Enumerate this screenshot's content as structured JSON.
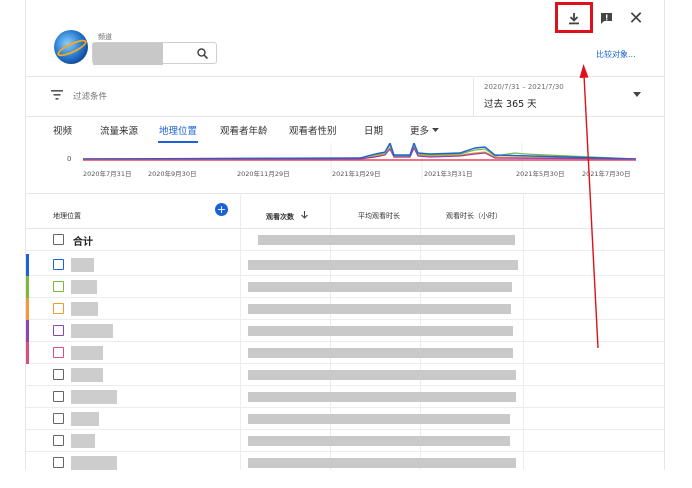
{
  "toolbar": {
    "download_icon": "download-icon",
    "feedback_icon": "feedback-icon",
    "close_label": "✕"
  },
  "channel": {
    "label": "频道",
    "compare_label": "比较对象..."
  },
  "filter": {
    "label": "过滤条件"
  },
  "date": {
    "range": "2020/7/31 – 2021/7/30",
    "label": "过去 365 天"
  },
  "tabs": [
    {
      "label": "视频"
    },
    {
      "label": "流量来源"
    },
    {
      "label": "地理位置"
    },
    {
      "label": "观看者年龄"
    },
    {
      "label": "观看者性别"
    },
    {
      "label": "日期"
    },
    {
      "label": "更多"
    }
  ],
  "chart_data": {
    "type": "line",
    "y_min_label": "0",
    "x_ticks": [
      "2020年7月31日",
      "2020年9月30日",
      "2020年11月29日",
      "2021年1月29日",
      "2021年3月31日",
      "2021年5月30日",
      "2021年7月30日"
    ],
    "series_colors": [
      "#1a62d6",
      "#e8425a",
      "#f29a38",
      "#7cb83d",
      "#8e44ad"
    ]
  },
  "table": {
    "headers": {
      "location": "地理位置",
      "views": "观看次数",
      "avg_duration": "平均观看时长",
      "watch_time": "观看时长（小时）"
    },
    "total_label": "合计",
    "row_colors": [
      "#1a62d6",
      "#7cb83d",
      "#f29a38",
      "#8e44ad",
      "#d9507a",
      "",
      "",
      "",
      "",
      "",
      ""
    ]
  },
  "colors": {
    "accent": "#1a62d6",
    "annotation": "#e0101a"
  }
}
